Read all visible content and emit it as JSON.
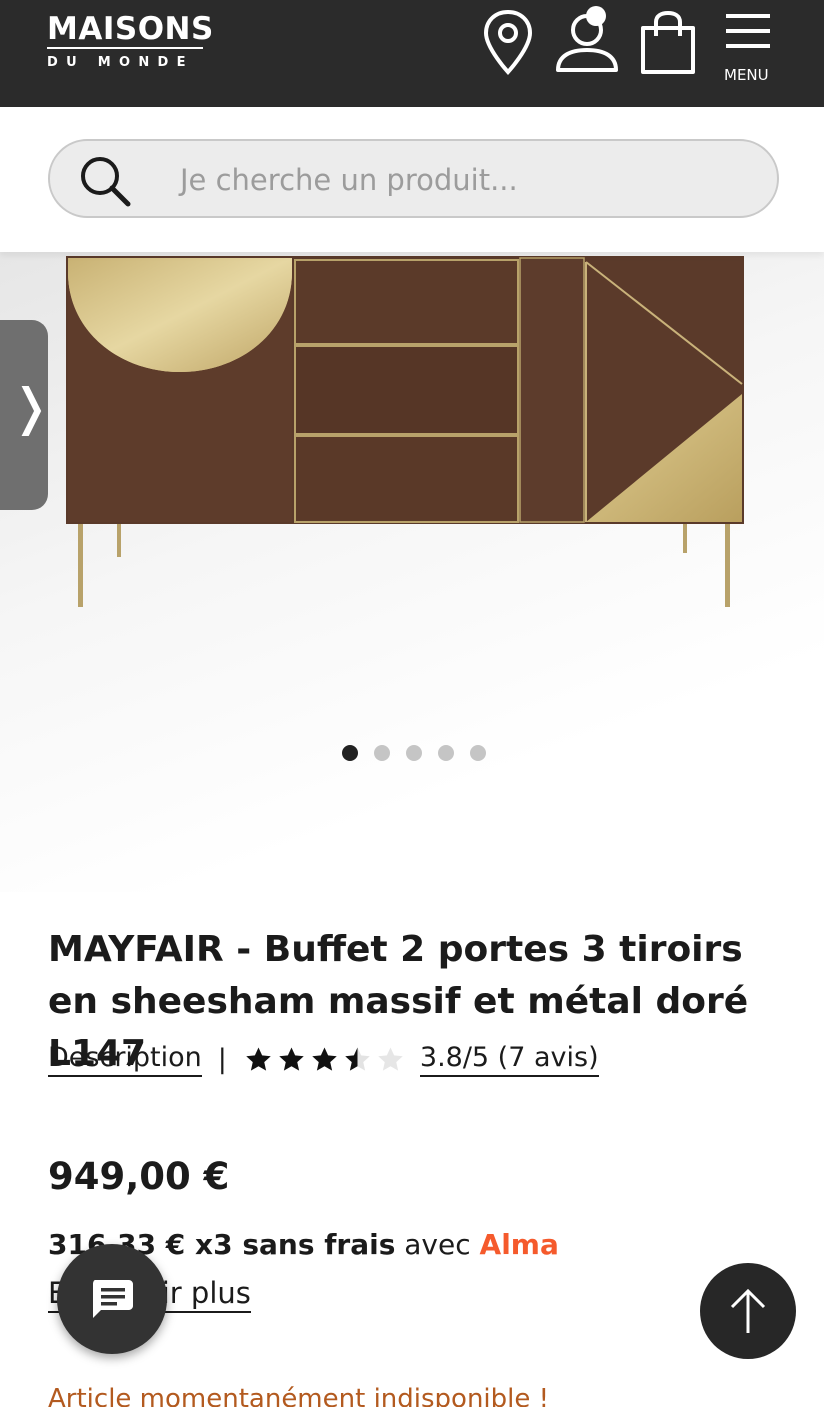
{
  "header": {
    "logo_main": "MAISONS",
    "logo_sub": "DU MONDE",
    "menu_label": "MENU",
    "icons": [
      "store-locator-icon",
      "account-icon",
      "cart-icon",
      "menu-icon"
    ]
  },
  "search": {
    "placeholder": "Je cherche un produit..."
  },
  "gallery": {
    "image_count": 5,
    "active_index": 0
  },
  "product": {
    "title": "MAYFAIR - Buffet 2 portes 3 tiroirs en sheesham massif et métal doré L147",
    "description_link": "Description",
    "separator": "|",
    "rating": 3.8,
    "rating_text": "3.8/5 (7 avis)",
    "price": "949,00 €",
    "installment_amount": "316,33 € x3 sans frais",
    "installment_with": " avec ",
    "installment_provider": "Alma",
    "learn_more": "En savoir plus",
    "availability": "Article momentanément indisponible !"
  },
  "colors": {
    "header_bg": "#2b2b2b",
    "alma": "#f55a2c",
    "availability": "#b35a1f"
  }
}
